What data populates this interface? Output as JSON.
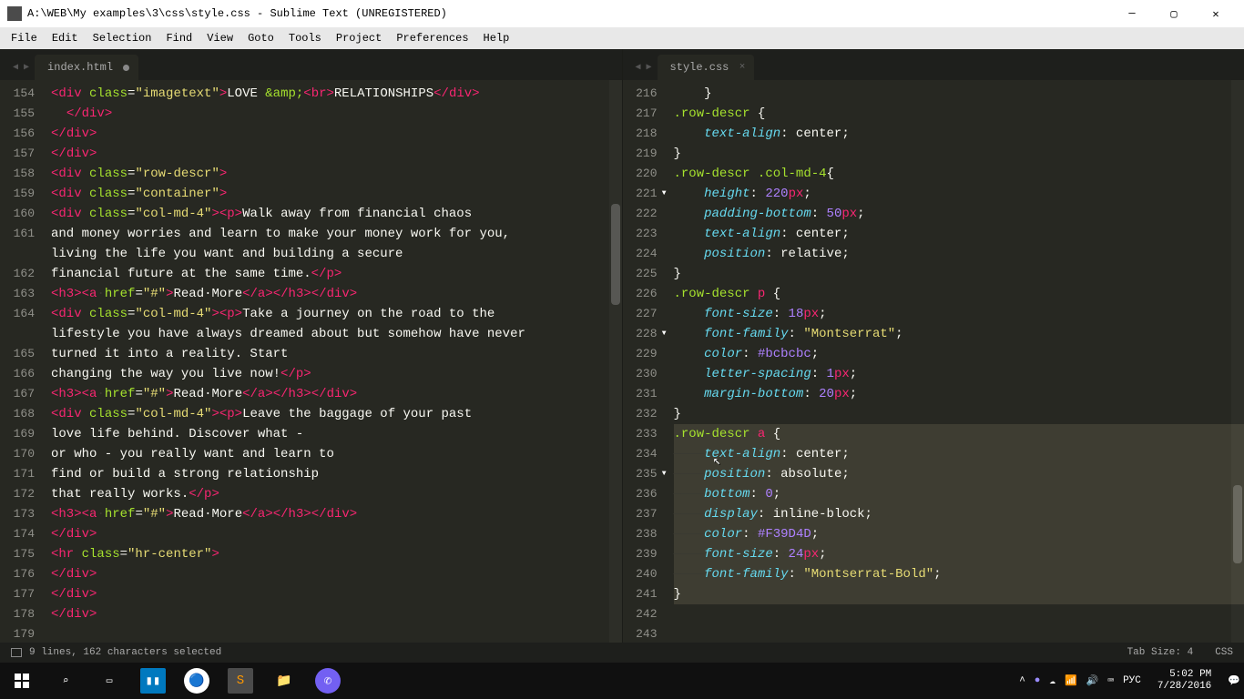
{
  "window": {
    "title": "A:\\WEB\\My examples\\3\\css\\style.css - Sublime Text (UNREGISTERED)"
  },
  "menu": [
    "File",
    "Edit",
    "Selection",
    "Find",
    "View",
    "Goto",
    "Tools",
    "Project",
    "Preferences",
    "Help"
  ],
  "panes": {
    "left": {
      "tab": "index.html",
      "lines": [
        "154",
        "155",
        "156",
        "157",
        "158",
        "159",
        "160",
        "161",
        "",
        "162",
        "163",
        "164",
        "",
        "165",
        "166",
        "167",
        "168",
        "169",
        "170",
        "171",
        "172",
        "173",
        "174",
        "175",
        "176",
        "177",
        "178",
        "179"
      ]
    },
    "right": {
      "tab": "style.css",
      "lines": [
        "216",
        "217",
        "218",
        "219",
        "220",
        "221",
        "222",
        "223",
        "224",
        "225",
        "226",
        "227",
        "228",
        "229",
        "230",
        "231",
        "232",
        "233",
        "234",
        "235",
        "236",
        "237",
        "238",
        "239",
        "240",
        "241",
        "242",
        "243"
      ],
      "fold_lines": [
        221,
        228,
        235
      ]
    }
  },
  "code_left": [
    {
      "segs": [
        [
          "tag",
          "<div "
        ],
        [
          "attr",
          "class"
        ],
        [
          "punc",
          "="
        ],
        [
          "str",
          "\"imagetext\""
        ],
        [
          "tag",
          ">"
        ],
        [
          "txt",
          "LOVE "
        ],
        [
          "attr",
          "&amp;"
        ],
        [
          "tag",
          "<br>"
        ],
        [
          "txt",
          "RELATIONSHIPS"
        ],
        [
          "tag",
          "</"
        ],
        [
          "tag",
          "div"
        ],
        [
          "tag",
          ">"
        ]
      ]
    },
    {
      "segs": [
        [
          "txt",
          "  "
        ],
        [
          "tag",
          "</"
        ],
        [
          "tag",
          "div"
        ],
        [
          "tag",
          ">"
        ]
      ]
    },
    {
      "segs": [
        [
          "tag",
          "</"
        ],
        [
          "tag",
          "div"
        ],
        [
          "tag",
          ">"
        ]
      ]
    },
    {
      "segs": [
        [
          "tag",
          "</"
        ],
        [
          "tag",
          "div"
        ],
        [
          "tag",
          ">"
        ]
      ]
    },
    {
      "segs": [
        [
          "tag",
          "<div "
        ],
        [
          "attr",
          "class"
        ],
        [
          "punc",
          "="
        ],
        [
          "str",
          "\"row-descr\""
        ],
        [
          "tag",
          ">"
        ]
      ]
    },
    {
      "segs": [
        [
          "tag",
          "<div "
        ],
        [
          "attr",
          "class"
        ],
        [
          "punc",
          "="
        ],
        [
          "str",
          "\"container\""
        ],
        [
          "tag",
          ">"
        ]
      ]
    },
    {
      "segs": [
        [
          "tag",
          "<div "
        ],
        [
          "attr",
          "class"
        ],
        [
          "punc",
          "="
        ],
        [
          "str",
          "\"col-md-4\""
        ],
        [
          "tag",
          "><p>"
        ],
        [
          "txt",
          "Walk away from financial chaos"
        ]
      ]
    },
    {
      "segs": [
        [
          "txt",
          "and money worries and learn to make your money work for you,"
        ]
      ]
    },
    {
      "segs": [
        [
          "txt",
          "living the life you want and building a secure"
        ]
      ]
    },
    {
      "segs": [
        [
          "txt",
          "financial future at the same time."
        ],
        [
          "tag",
          "</p>"
        ]
      ]
    },
    {
      "segs": [
        [
          "tag",
          "<h3><a "
        ],
        [
          "attr",
          "href"
        ],
        [
          "punc",
          "="
        ],
        [
          "str",
          "\"#\""
        ],
        [
          "tag",
          ">"
        ],
        [
          "txt",
          "Read More"
        ],
        [
          "tag",
          "</a></h3></div>"
        ]
      ],
      "dots": true
    },
    {
      "segs": [
        [
          "tag",
          "<div "
        ],
        [
          "attr",
          "class"
        ],
        [
          "punc",
          "="
        ],
        [
          "str",
          "\"col-md-4\""
        ],
        [
          "tag",
          "><p>"
        ],
        [
          "txt",
          "Take a journey on the road to the"
        ]
      ]
    },
    {
      "segs": [
        [
          "txt",
          "lifestyle you have always dreamed about but somehow have never"
        ]
      ]
    },
    {
      "segs": [
        [
          "txt",
          "turned it into a reality. Start"
        ]
      ]
    },
    {
      "segs": [
        [
          "txt",
          "changing the way you live now!"
        ],
        [
          "tag",
          "</p>"
        ]
      ]
    },
    {
      "segs": [
        [
          "tag",
          "<h3><a "
        ],
        [
          "attr",
          "href"
        ],
        [
          "punc",
          "="
        ],
        [
          "str",
          "\"#\""
        ],
        [
          "tag",
          ">"
        ],
        [
          "txt",
          "Read More"
        ],
        [
          "tag",
          "</a></h3></div>"
        ]
      ],
      "dots": true
    },
    {
      "segs": [
        [
          "tag",
          "<div "
        ],
        [
          "attr",
          "class"
        ],
        [
          "punc",
          "="
        ],
        [
          "str",
          "\"col-md-4\""
        ],
        [
          "tag",
          "><p>"
        ],
        [
          "txt",
          "Leave the baggage of your past"
        ]
      ]
    },
    {
      "segs": [
        [
          "txt",
          "love life behind. Discover what -"
        ]
      ]
    },
    {
      "segs": [
        [
          "txt",
          "or who - you really want and learn to"
        ]
      ]
    },
    {
      "segs": [
        [
          "txt",
          "find or build a strong relationship"
        ]
      ]
    },
    {
      "segs": [
        [
          "txt",
          "that really works."
        ],
        [
          "tag",
          "</p>"
        ]
      ]
    },
    {
      "segs": [
        [
          "tag",
          "<h3><a "
        ],
        [
          "attr",
          "href"
        ],
        [
          "punc",
          "="
        ],
        [
          "str",
          "\"#\""
        ],
        [
          "tag",
          ">"
        ],
        [
          "txt",
          "Read More"
        ],
        [
          "tag",
          "</a></h3></div>"
        ]
      ],
      "dots": true
    },
    {
      "segs": [
        [
          "txt",
          ""
        ]
      ]
    },
    {
      "segs": [
        [
          "tag",
          "</"
        ],
        [
          "tag",
          "div"
        ],
        [
          "tag",
          ">"
        ]
      ]
    },
    {
      "segs": [
        [
          "tag",
          "<hr "
        ],
        [
          "attr",
          "class"
        ],
        [
          "punc",
          "="
        ],
        [
          "str",
          "\"hr-center\""
        ],
        [
          "tag",
          ">"
        ]
      ]
    },
    {
      "segs": [
        [
          "tag",
          "</"
        ],
        [
          "tag",
          "div"
        ],
        [
          "tag",
          ">"
        ]
      ]
    },
    {
      "segs": [
        [
          "tag",
          "</"
        ],
        [
          "tag",
          "div"
        ],
        [
          "tag",
          ">"
        ]
      ]
    },
    {
      "segs": [
        [
          "tag",
          "</"
        ],
        [
          "tag",
          "div"
        ],
        [
          "tag",
          ">"
        ]
      ]
    }
  ],
  "code_right": [
    {
      "segs": [
        [
          "txt",
          "    }"
        ]
      ]
    },
    {
      "segs": [
        [
          "txt",
          ""
        ]
      ]
    },
    {
      "segs": [
        [
          "sel",
          ".row-descr"
        ],
        [
          "txt",
          " {"
        ]
      ]
    },
    {
      "segs": [
        [
          "txt",
          "    "
        ],
        [
          "prop",
          "text-align"
        ],
        [
          "txt",
          ": center;"
        ]
      ]
    },
    {
      "segs": [
        [
          "txt",
          "}"
        ]
      ]
    },
    {
      "segs": [
        [
          "sel",
          ".row-descr .col-md-4"
        ],
        [
          "txt",
          "{"
        ]
      ]
    },
    {
      "segs": [
        [
          "txt",
          ""
        ]
      ]
    },
    {
      "segs": [
        [
          "txt",
          "    "
        ],
        [
          "prop",
          "height"
        ],
        [
          "txt",
          ": "
        ],
        [
          "num",
          "220"
        ],
        [
          "unit",
          "px"
        ],
        [
          "txt",
          ";"
        ]
      ]
    },
    {
      "segs": [
        [
          "txt",
          "    "
        ],
        [
          "prop",
          "padding-bottom"
        ],
        [
          "txt",
          ": "
        ],
        [
          "num",
          "50"
        ],
        [
          "unit",
          "px"
        ],
        [
          "txt",
          ";"
        ]
      ]
    },
    {
      "segs": [
        [
          "txt",
          "    "
        ],
        [
          "prop",
          "text-align"
        ],
        [
          "txt",
          ": center;"
        ]
      ]
    },
    {
      "segs": [
        [
          "txt",
          "    "
        ],
        [
          "prop",
          "position"
        ],
        [
          "txt",
          ": relative;"
        ]
      ]
    },
    {
      "segs": [
        [
          "txt",
          "}"
        ]
      ]
    },
    {
      "segs": [
        [
          "sel",
          ".row-descr "
        ],
        [
          "tagsel",
          "p"
        ],
        [
          "txt",
          " {"
        ]
      ]
    },
    {
      "segs": [
        [
          "txt",
          "    "
        ],
        [
          "prop",
          "font-size"
        ],
        [
          "txt",
          ": "
        ],
        [
          "num",
          "18"
        ],
        [
          "unit",
          "px"
        ],
        [
          "txt",
          ";"
        ]
      ]
    },
    {
      "segs": [
        [
          "txt",
          "    "
        ],
        [
          "prop",
          "font-family"
        ],
        [
          "txt",
          ": "
        ],
        [
          "str",
          "\"Montserrat\""
        ],
        [
          "txt",
          ";"
        ]
      ]
    },
    {
      "segs": [
        [
          "txt",
          "    "
        ],
        [
          "prop",
          "color"
        ],
        [
          "txt",
          ": "
        ],
        [
          "num",
          "#bcbcbc"
        ],
        [
          "txt",
          ";"
        ]
      ]
    },
    {
      "segs": [
        [
          "txt",
          "    "
        ],
        [
          "prop",
          "letter-spacing"
        ],
        [
          "txt",
          ": "
        ],
        [
          "num",
          "1"
        ],
        [
          "unit",
          "px"
        ],
        [
          "txt",
          ";"
        ]
      ]
    },
    {
      "segs": [
        [
          "txt",
          "    "
        ],
        [
          "prop",
          "margin-bottom"
        ],
        [
          "txt",
          ": "
        ],
        [
          "num",
          "20"
        ],
        [
          "unit",
          "px"
        ],
        [
          "txt",
          ";"
        ]
      ]
    },
    {
      "segs": [
        [
          "txt",
          "}"
        ]
      ]
    },
    {
      "sel": true,
      "segs": [
        [
          "sel",
          ".row-descr"
        ],
        [
          "ws",
          "·"
        ],
        [
          "tagsel",
          "a"
        ],
        [
          "ws",
          "·"
        ],
        [
          "txt",
          "{"
        ]
      ]
    },
    {
      "sel": true,
      "segs": [
        [
          "ws",
          "————"
        ],
        [
          "prop",
          "text-align"
        ],
        [
          "txt",
          ":"
        ],
        [
          "ws",
          "·"
        ],
        [
          "txt",
          "center;"
        ]
      ]
    },
    {
      "sel": true,
      "segs": [
        [
          "ws",
          "————"
        ],
        [
          "prop",
          "position"
        ],
        [
          "txt",
          ":"
        ],
        [
          "ws",
          "·"
        ],
        [
          "txt",
          "absolute;"
        ]
      ]
    },
    {
      "sel": true,
      "segs": [
        [
          "ws",
          "————"
        ],
        [
          "prop",
          "bottom"
        ],
        [
          "txt",
          ":"
        ],
        [
          "ws",
          "·"
        ],
        [
          "num",
          "0"
        ],
        [
          "txt",
          ";"
        ]
      ]
    },
    {
      "sel": true,
      "segs": [
        [
          "ws",
          "————"
        ],
        [
          "prop",
          "display"
        ],
        [
          "txt",
          ":"
        ],
        [
          "ws",
          "·"
        ],
        [
          "txt",
          "inline-block;"
        ]
      ]
    },
    {
      "sel": true,
      "segs": [
        [
          "ws",
          "————"
        ],
        [
          "prop",
          "color"
        ],
        [
          "txt",
          ":"
        ],
        [
          "ws",
          "·"
        ],
        [
          "num",
          "#F39D4D"
        ],
        [
          "txt",
          ";"
        ]
      ]
    },
    {
      "sel": true,
      "segs": [
        [
          "ws",
          "————"
        ],
        [
          "prop",
          "font-size"
        ],
        [
          "txt",
          ":"
        ],
        [
          "ws",
          "·"
        ],
        [
          "num",
          "24"
        ],
        [
          "unit",
          "px"
        ],
        [
          "txt",
          ";"
        ]
      ]
    },
    {
      "sel": true,
      "segs": [
        [
          "ws",
          "————"
        ],
        [
          "prop",
          "font-family"
        ],
        [
          "txt",
          ":"
        ],
        [
          "ws",
          "·"
        ],
        [
          "str",
          "\"Montserrat-Bold\""
        ],
        [
          "txt",
          ";"
        ]
      ]
    },
    {
      "sel": true,
      "segs": [
        [
          "txt",
          "}"
        ]
      ]
    }
  ],
  "status": {
    "left": "9 lines, 162 characters selected",
    "tabsize": "Tab Size: 4",
    "syntax": "CSS"
  },
  "taskbar": {
    "time": "5:02 PM",
    "date": "7/28/2016",
    "lang": "РУС"
  }
}
